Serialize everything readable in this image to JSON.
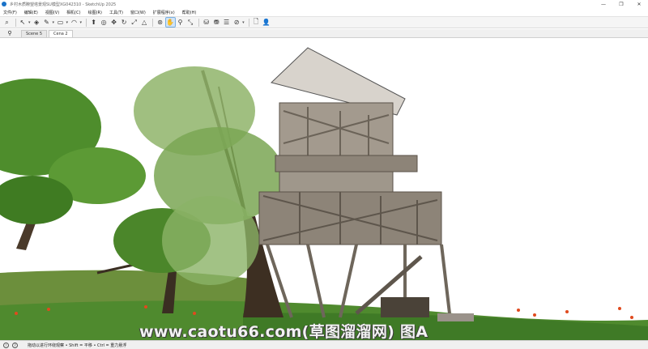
{
  "window": {
    "title": "乡村木质瞭望塔景观SU模型XG042310 - SketchUp 2025",
    "controls": [
      "—",
      "❐",
      "✕"
    ]
  },
  "menu": {
    "items": [
      "文件(F)",
      "编辑(E)",
      "视图(V)",
      "相机(C)",
      "绘图(R)",
      "工具(T)",
      "窗口(W)",
      "扩展程序(x)",
      "帮助(H)"
    ]
  },
  "toolbar": {
    "tools": [
      {
        "icon": "search-icon",
        "glyph": "⌕"
      },
      {
        "icon": "select-arrow-icon",
        "glyph": "↖"
      },
      {
        "icon": "paint-bucket-icon",
        "glyph": "◈"
      },
      {
        "icon": "pencil-icon",
        "glyph": "✎"
      },
      {
        "icon": "rectangle-icon",
        "glyph": "▭"
      },
      {
        "icon": "arc-icon",
        "glyph": "◠"
      },
      {
        "icon": "push-pull-icon",
        "glyph": "⬆"
      },
      {
        "icon": "offset-icon",
        "glyph": "◎"
      },
      {
        "icon": "move-icon",
        "glyph": "✥"
      },
      {
        "icon": "rotate-icon",
        "glyph": "↻"
      },
      {
        "icon": "scale-icon",
        "glyph": "⤢"
      },
      {
        "icon": "tape-measure-icon",
        "glyph": "△"
      },
      {
        "icon": "orbit-icon",
        "glyph": "⊛"
      },
      {
        "icon": "pan-icon",
        "glyph": "✋"
      },
      {
        "icon": "zoom-icon",
        "glyph": "⚲"
      },
      {
        "icon": "zoom-extents-icon",
        "glyph": "⤡"
      },
      {
        "icon": "warehouse-icon",
        "glyph": "⛁"
      },
      {
        "icon": "extension-warehouse-icon",
        "glyph": "⛃"
      },
      {
        "icon": "layout-icon",
        "glyph": "☰"
      },
      {
        "icon": "section-icon",
        "glyph": "⊘"
      },
      {
        "icon": "new-file-icon",
        "glyph": "🗋"
      },
      {
        "icon": "user-icon",
        "glyph": "👤"
      }
    ]
  },
  "tabs": {
    "search_glyph": "⚲",
    "scenes": [
      "Scene 5",
      "Cena 2"
    ],
    "active_index": 1
  },
  "watermark": "www.caotu66.com(草图溜溜网) 图A",
  "status": {
    "icon1": "!",
    "icon2": "?",
    "text": "拖动以进行环绕观察 • Shift = 平移 • Ctrl = 重力悬浮"
  },
  "colors": {
    "sky": "#ffffff",
    "grass": "#4f8a2e",
    "wood": "#8d8478",
    "roof": "#d8d3cc",
    "foliage": "#5f9a3a",
    "active_tool": "#cfe3f7"
  }
}
